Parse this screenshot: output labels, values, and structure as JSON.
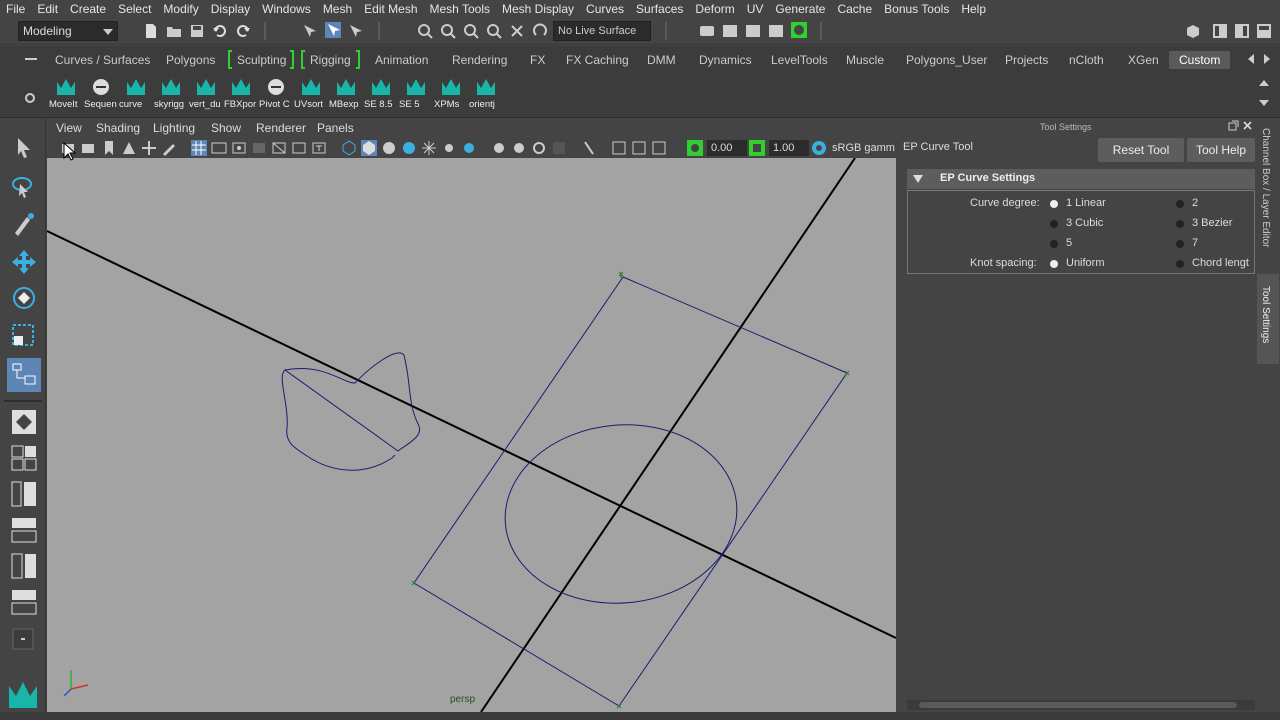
{
  "menubar": [
    "File",
    "Edit",
    "Create",
    "Select",
    "Modify",
    "Display",
    "Windows",
    "Mesh",
    "Edit Mesh",
    "Mesh Tools",
    "Mesh Display",
    "Curves",
    "Surfaces",
    "Deform",
    "UV",
    "Generate",
    "Cache",
    "Bonus Tools",
    "Help"
  ],
  "status": {
    "mode": "Modeling",
    "live_surface": "No Live Surface"
  },
  "shelf_tabs": [
    "Curves / Surfaces",
    "Polygons",
    "Sculpting",
    "Rigging",
    "Animation",
    "Rendering",
    "FX",
    "FX Caching",
    "DMM",
    "Dynamics",
    "LevelTools",
    "Muscle",
    "Polygons_User",
    "Projects",
    "nCloth",
    "XGen",
    "Custom"
  ],
  "shelf_active_tab": "Custom",
  "shelf_items": [
    "MoveIt",
    "Sequen",
    "curve",
    "skyrigg",
    "vert_du",
    "FBXpor",
    "Pivot C",
    "UVsort",
    "MBexp",
    "SE 8.5",
    "SE 5",
    "XPMs",
    "orientj"
  ],
  "viewport_menu": [
    "View",
    "Shading",
    "Lighting",
    "Show",
    "Renderer",
    "Panels"
  ],
  "viewport": {
    "gamma_label": "sRGB gamm",
    "exposure": "0.00",
    "gamma": "1.00",
    "camera_label": "persp"
  },
  "tool_settings": {
    "header": "Tool Settings",
    "tool_name": "EP Curve Tool",
    "reset_label": "Reset Tool",
    "help_label": "Tool Help",
    "section": "EP Curve Settings",
    "curve_degree_label": "Curve degree:",
    "degree_options": [
      "1 Linear",
      "2",
      "3 Cubic",
      "3 Bezier",
      "5",
      "7"
    ],
    "degree_selected": "1 Linear",
    "knot_label": "Knot spacing:",
    "knot_options": [
      "Uniform",
      "Chord lengt"
    ],
    "knot_selected": "Uniform"
  },
  "side_tabs": {
    "channel_box": "Channel Box / Layer Editor",
    "tool_settings": "Tool Settings"
  },
  "colors": {
    "accent_green": "#30d030",
    "curve": "#1c1c6e",
    "viewport_bg": "#a3a3a3",
    "maya_teal": "#18b5a8"
  }
}
